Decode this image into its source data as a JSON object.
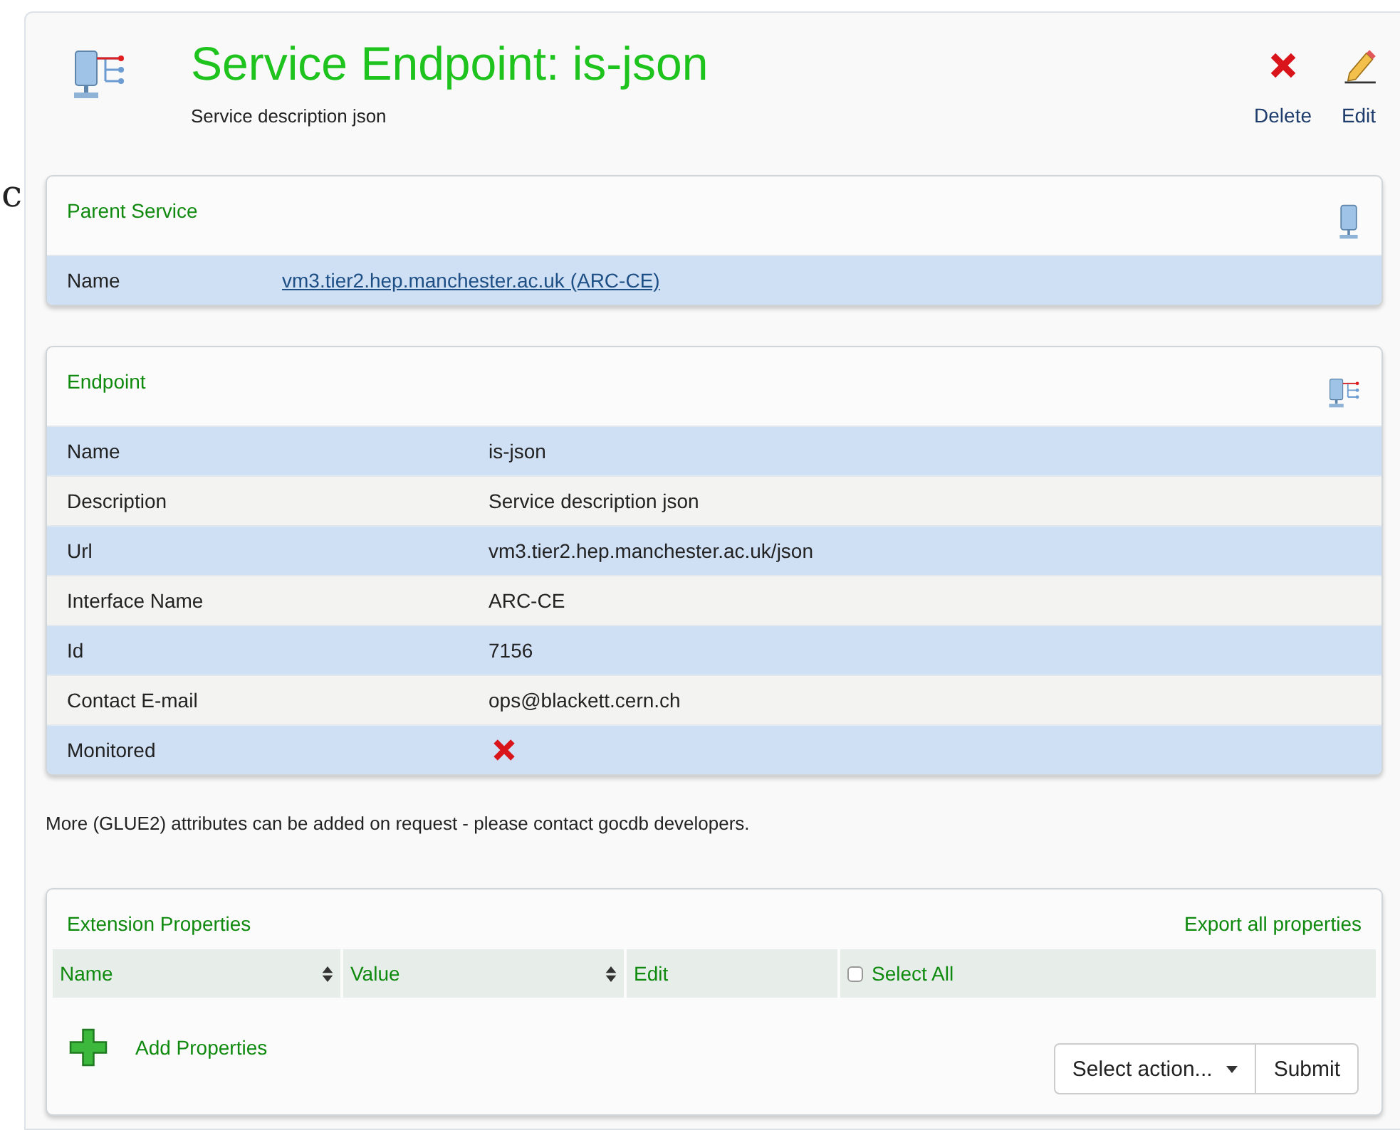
{
  "edge_text": "c",
  "header": {
    "title": "Service Endpoint: is-json",
    "subtitle": "Service description json",
    "actions": [
      {
        "kind": "delete",
        "label": "Delete"
      },
      {
        "kind": "edit",
        "label": "Edit"
      }
    ]
  },
  "parent_service": {
    "title": "Parent Service",
    "rows": [
      {
        "label": "Name",
        "value": "vm3.tier2.hep.manchester.ac.uk (ARC-CE)",
        "kind": "link"
      }
    ]
  },
  "endpoint": {
    "title": "Endpoint",
    "rows": [
      {
        "label": "Name",
        "value": "is-json",
        "kind": "text"
      },
      {
        "label": "Description",
        "value": "Service description json",
        "kind": "text"
      },
      {
        "label": "Url",
        "value": "vm3.tier2.hep.manchester.ac.uk/json",
        "kind": "text"
      },
      {
        "label": "Interface Name",
        "value": "ARC-CE",
        "kind": "text"
      },
      {
        "label": "Id",
        "value": "7156",
        "kind": "text"
      },
      {
        "label": "Contact E-mail",
        "value": "ops@blackett.cern.ch",
        "kind": "text"
      },
      {
        "label": "Monitored",
        "kind": "flag",
        "on": false
      }
    ]
  },
  "note": "More (GLUE2) attributes can be added on request - please contact gocdb developers.",
  "extension_properties": {
    "title": "Extension Properties",
    "export_link": "Export all properties",
    "columns": [
      {
        "label": "Name",
        "sortable": true
      },
      {
        "label": "Value",
        "sortable": true
      },
      {
        "label": "Edit",
        "sortable": false
      },
      {
        "label": "Select All",
        "kind": "checkbox",
        "checked": false
      }
    ],
    "add_link": "Add Properties",
    "action_select": "Select action...",
    "submit": "Submit"
  }
}
